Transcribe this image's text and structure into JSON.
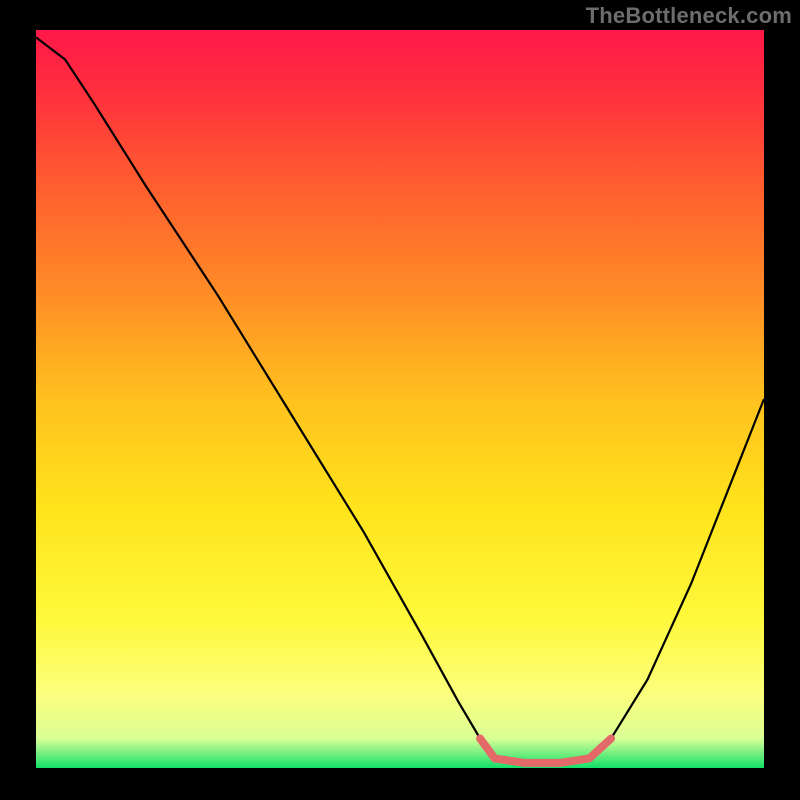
{
  "attribution": "TheBottleneck.com",
  "chart_data": {
    "type": "line",
    "title": "",
    "xlabel": "",
    "ylabel": "",
    "xlim": [
      0,
      100
    ],
    "ylim": [
      0,
      100
    ],
    "grid": false,
    "gradient": {
      "stops": [
        {
          "offset": 0.0,
          "color": "#ff1849"
        },
        {
          "offset": 0.08,
          "color": "#ff2e3e"
        },
        {
          "offset": 0.2,
          "color": "#ff5a30"
        },
        {
          "offset": 0.35,
          "color": "#ff8a27"
        },
        {
          "offset": 0.5,
          "color": "#ffc11e"
        },
        {
          "offset": 0.65,
          "color": "#ffe41c"
        },
        {
          "offset": 0.8,
          "color": "#fff93c"
        },
        {
          "offset": 0.9,
          "color": "#fcff7d"
        },
        {
          "offset": 0.96,
          "color": "#d9ff95"
        },
        {
          "offset": 1.0,
          "color": "#12e06a"
        }
      ]
    },
    "series": [
      {
        "name": "curve",
        "color": "#000000",
        "width": 2.2,
        "points": [
          {
            "x": 0,
            "y": 99
          },
          {
            "x": 4,
            "y": 96
          },
          {
            "x": 8,
            "y": 90
          },
          {
            "x": 15,
            "y": 79
          },
          {
            "x": 25,
            "y": 64
          },
          {
            "x": 35,
            "y": 48
          },
          {
            "x": 45,
            "y": 32
          },
          {
            "x": 53,
            "y": 18
          },
          {
            "x": 58,
            "y": 9
          },
          {
            "x": 61,
            "y": 4
          },
          {
            "x": 63,
            "y": 1.2
          },
          {
            "x": 67,
            "y": 0.6
          },
          {
            "x": 72,
            "y": 0.6
          },
          {
            "x": 76,
            "y": 1.2
          },
          {
            "x": 79,
            "y": 4
          },
          {
            "x": 84,
            "y": 12
          },
          {
            "x": 90,
            "y": 25
          },
          {
            "x": 96,
            "y": 40
          },
          {
            "x": 100,
            "y": 50
          }
        ]
      },
      {
        "name": "highlight",
        "color": "#e46a6a",
        "width": 8,
        "rounded": true,
        "points": [
          {
            "x": 61,
            "y": 4
          },
          {
            "x": 63,
            "y": 1.3
          },
          {
            "x": 67,
            "y": 0.7
          },
          {
            "x": 72,
            "y": 0.7
          },
          {
            "x": 76,
            "y": 1.3
          },
          {
            "x": 79,
            "y": 4
          }
        ]
      }
    ]
  }
}
